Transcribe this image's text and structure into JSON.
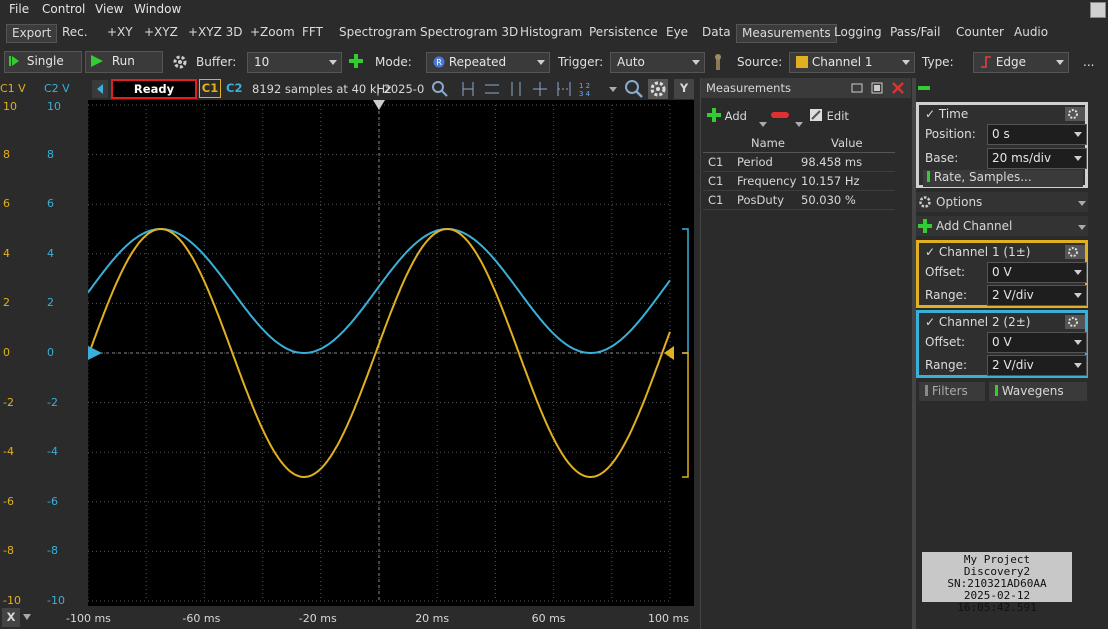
{
  "menu": [
    "File",
    "Control",
    "View",
    "Window"
  ],
  "tabs": [
    "Export",
    "Rec.",
    "+XY",
    "+XYZ",
    "+XYZ 3D",
    "+Zoom",
    "FFT",
    "Spectrogram",
    "Spectrogram 3D",
    "Histogram",
    "Persistence",
    "Eye",
    "Data",
    "Measurements",
    "Logging",
    "Pass/Fail",
    "Counter",
    "Audio"
  ],
  "active_tab": "Measurements",
  "toolbar": {
    "single": "Single",
    "run": "Run",
    "buffer_label": "Buffer:",
    "buffer_value": "10",
    "mode_label": "Mode:",
    "mode_value": "Repeated",
    "trigger_label": "Trigger:",
    "trigger_value": "Auto",
    "source_label": "Source:",
    "source_value": "Channel 1",
    "type_label": "Type:",
    "type_value": "Edge",
    "more": "..."
  },
  "scope": {
    "c1_header": "C1 V",
    "c2_header": "C2 V",
    "status": "Ready",
    "c1": "C1",
    "c2": "C2",
    "samples_text": "8192 samples at 40 kHz",
    "date_text": "| 2025-0",
    "y_button": "Y",
    "x_button": "X"
  },
  "y_ticks": [
    "10",
    "8",
    "6",
    "4",
    "2",
    "0",
    "-2",
    "-4",
    "-6",
    "-8",
    "-10"
  ],
  "x_ticks": [
    "-100 ms",
    "-60 ms",
    "-20 ms",
    "20 ms",
    "60 ms",
    "100 ms"
  ],
  "colors": {
    "c1": "#e0b020",
    "c2": "#3ab0d8",
    "status_border": "#e02020"
  },
  "chart_data": {
    "type": "line",
    "xlabel": "",
    "ylabel": "",
    "xlim": [
      -100,
      100
    ],
    "ylim": [
      -10,
      10
    ],
    "grid": true,
    "series": [
      {
        "name": "C1",
        "waveform": "sine",
        "amplitude": 5,
        "offset": 0,
        "period_ms": 98.458,
        "phase_ms_of_peak": -75
      },
      {
        "name": "C2",
        "waveform": "sine",
        "amplitude": 2.5,
        "offset": 2.5,
        "period_ms": 98.458,
        "phase_ms_of_peak": -75
      }
    ]
  },
  "measurements": {
    "title": "Measurements",
    "add": "Add",
    "edit": "Edit",
    "columns": [
      "Name",
      "Value"
    ],
    "rows": [
      {
        "ch": "C1",
        "name": "Period",
        "value": "98.458 ms"
      },
      {
        "ch": "C1",
        "name": "Frequency",
        "value": "10.157 Hz"
      },
      {
        "ch": "C1",
        "name": "PosDuty",
        "value": "50.030 %"
      }
    ]
  },
  "panel": {
    "time_title": "Time",
    "position_label": "Position:",
    "position_value": "0 s",
    "base_label": "Base:",
    "base_value": "20 ms/div",
    "rate_button": "Rate, Samples...",
    "options": "Options",
    "add_channel": "Add Channel",
    "ch1_title": "Channel 1 (1±)",
    "ch2_title": "Channel 2 (2±)",
    "offset_label": "Offset:",
    "range_label": "Range:",
    "ch1_offset": "0 V",
    "ch1_range": "2 V/div",
    "ch2_offset": "0 V",
    "ch2_range": "2 V/div",
    "filters": "Filters",
    "wavegens": "Wavegens"
  },
  "info": {
    "line1": "My Project",
    "line2": "Discovery2",
    "line3": "SN:210321AD60AA",
    "line4": "2025-02-12 16:05:42.591"
  }
}
